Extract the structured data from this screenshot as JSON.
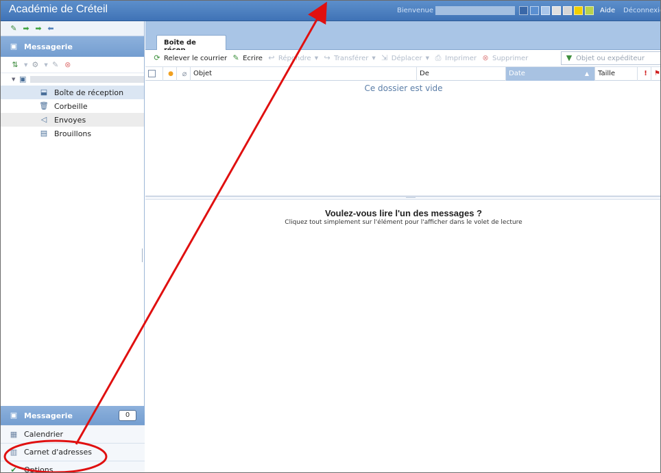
{
  "header": {
    "app_title": "Académie de Créteil",
    "welcome": "Bienvenue",
    "help": "Aide",
    "logout": "Déconnexion",
    "swatch_colors": [
      "#3a68a8",
      "#5a8fd1",
      "#a9c6ea",
      "#e0e0e0",
      "#d6d6d6",
      "#f2d000",
      "#b9d24c"
    ]
  },
  "sidebar": {
    "section_title": "Messagerie",
    "folders": [
      {
        "label": "Boîte de réception",
        "icon": "inbox-icon"
      },
      {
        "label": "Corbeille",
        "icon": "trash-icon"
      },
      {
        "label": "Envoyes",
        "icon": "sent-icon"
      },
      {
        "label": "Brouillons",
        "icon": "drafts-icon"
      }
    ],
    "nav": {
      "mail": "Messagerie",
      "mail_count": "0",
      "calendar": "Calendrier",
      "addressbook": "Carnet d'adresses",
      "options": "Options"
    }
  },
  "main": {
    "tab_label": "Boîte de récep...",
    "toolbar": {
      "fetch": "Relever le courrier",
      "write": "Ecrire",
      "reply": "Répondre",
      "forward": "Transférer",
      "move": "Déplacer",
      "print": "Imprimer",
      "delete": "Supprimer"
    },
    "search_placeholder": "Objet ou expéditeur",
    "columns": {
      "subject": "Objet",
      "from": "De",
      "date": "Date",
      "size": "Taille"
    },
    "empty_folder": "Ce dossier est vide",
    "reading_title": "Voulez-vous lire l'un des messages ?",
    "reading_sub": "Cliquez tout simplement sur l'élément pour l'afficher dans le volet de lecture"
  },
  "annotation": {
    "color": "#e01010"
  }
}
